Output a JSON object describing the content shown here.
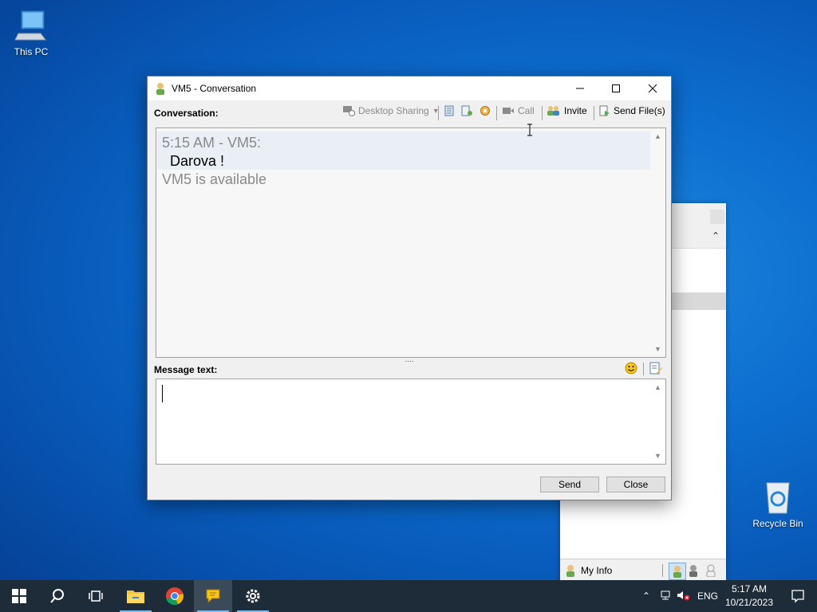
{
  "desktop": {
    "this_pc_label": "This PC",
    "recycle_bin_label": "Recycle Bin"
  },
  "background_window": {
    "footer_label": "My Info"
  },
  "conversation_window": {
    "title": "VM5 - Conversation",
    "conversation_label": "Conversation:",
    "toolbar": {
      "desktop_sharing": "Desktop Sharing",
      "call": "Call",
      "invite": "Invite",
      "send_files": "Send File(s)"
    },
    "history": {
      "header": "5:15 AM - VM5:",
      "message": "Darova !",
      "status": "VM5 is available"
    },
    "message_text_label": "Message text:",
    "send_button": "Send",
    "close_button": "Close"
  },
  "taskbar": {
    "language": "ENG",
    "time": "5:17 AM",
    "date": "10/21/2023"
  },
  "colors": {
    "accent": "#0078d7",
    "taskbar": "#1e2b38",
    "history_grey": "#8a8a8a"
  }
}
